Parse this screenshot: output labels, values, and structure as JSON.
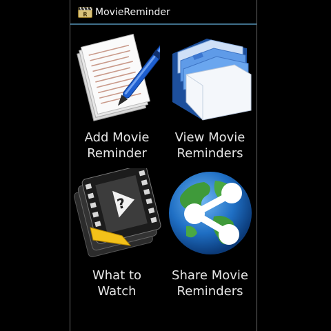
{
  "app": {
    "title": "MovieReminder"
  },
  "tiles": [
    {
      "line1": "Add Movie",
      "line2": "Reminder",
      "icon": "notepad-pen-icon"
    },
    {
      "line1": "View Movie",
      "line2": "Reminders",
      "icon": "blue-folder-icon"
    },
    {
      "line1": "What to",
      "line2": "Watch",
      "icon": "film-question-icon"
    },
    {
      "line1": "Share Movie",
      "line2": "Reminders",
      "icon": "globe-share-icon"
    }
  ]
}
